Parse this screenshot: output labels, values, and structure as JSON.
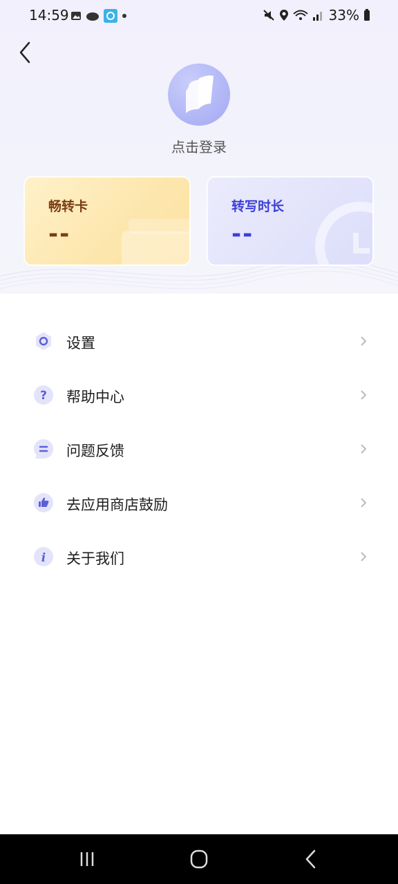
{
  "status": {
    "time": "14:59",
    "battery": "33%"
  },
  "profile": {
    "login_label": "点击登录"
  },
  "cards": [
    {
      "title": "畅转卡",
      "value": "--"
    },
    {
      "title": "转写时长",
      "value": "--"
    }
  ],
  "menu": [
    {
      "label": "设置",
      "icon": "settings-icon"
    },
    {
      "label": "帮助中心",
      "icon": "help-icon"
    },
    {
      "label": "问题反馈",
      "icon": "feedback-icon"
    },
    {
      "label": "去应用商店鼓励",
      "icon": "thumbs-up-icon"
    },
    {
      "label": "关于我们",
      "icon": "info-icon"
    }
  ],
  "colors": {
    "accent": "#3b3fd6",
    "gold": "#7a3d14",
    "icon_bg": "#e3e4fa",
    "icon_fg": "#5b5fd8"
  }
}
